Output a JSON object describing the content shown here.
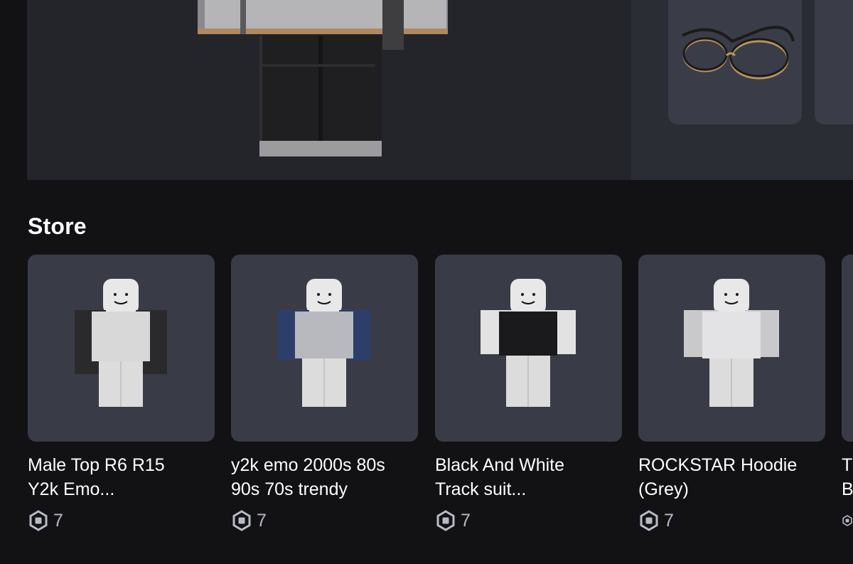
{
  "store": {
    "title": "Store",
    "items": [
      {
        "name": "Male Top R6 R15\nY2k Emo...",
        "price": "7",
        "shirt_color": "#2a2a2c",
        "shirt_front": "#d8d8d8"
      },
      {
        "name": "y2k emo 2000s 80s\n90s 70s trendy",
        "price": "7",
        "shirt_color": "#2c3f6b",
        "shirt_front": "#b7b9be"
      },
      {
        "name": "Black And White\nTrack suit...",
        "price": "7",
        "shirt_color": "#1a1a1c",
        "shirt_front": "#e2e2e2"
      },
      {
        "name": "ROCKSTAR Hoodie\n(Grey)",
        "price": "7",
        "shirt_color": "#c9c9cb",
        "shirt_front": "#e3e3e5"
      },
      {
        "name": "T\nB",
        "price": ""
      }
    ]
  },
  "colors": {
    "background": "#121215",
    "card": "#393b46",
    "price_text": "#b8bac4"
  },
  "icons": {
    "currency": "robux-icon",
    "accessory": "glasses-icon"
  }
}
